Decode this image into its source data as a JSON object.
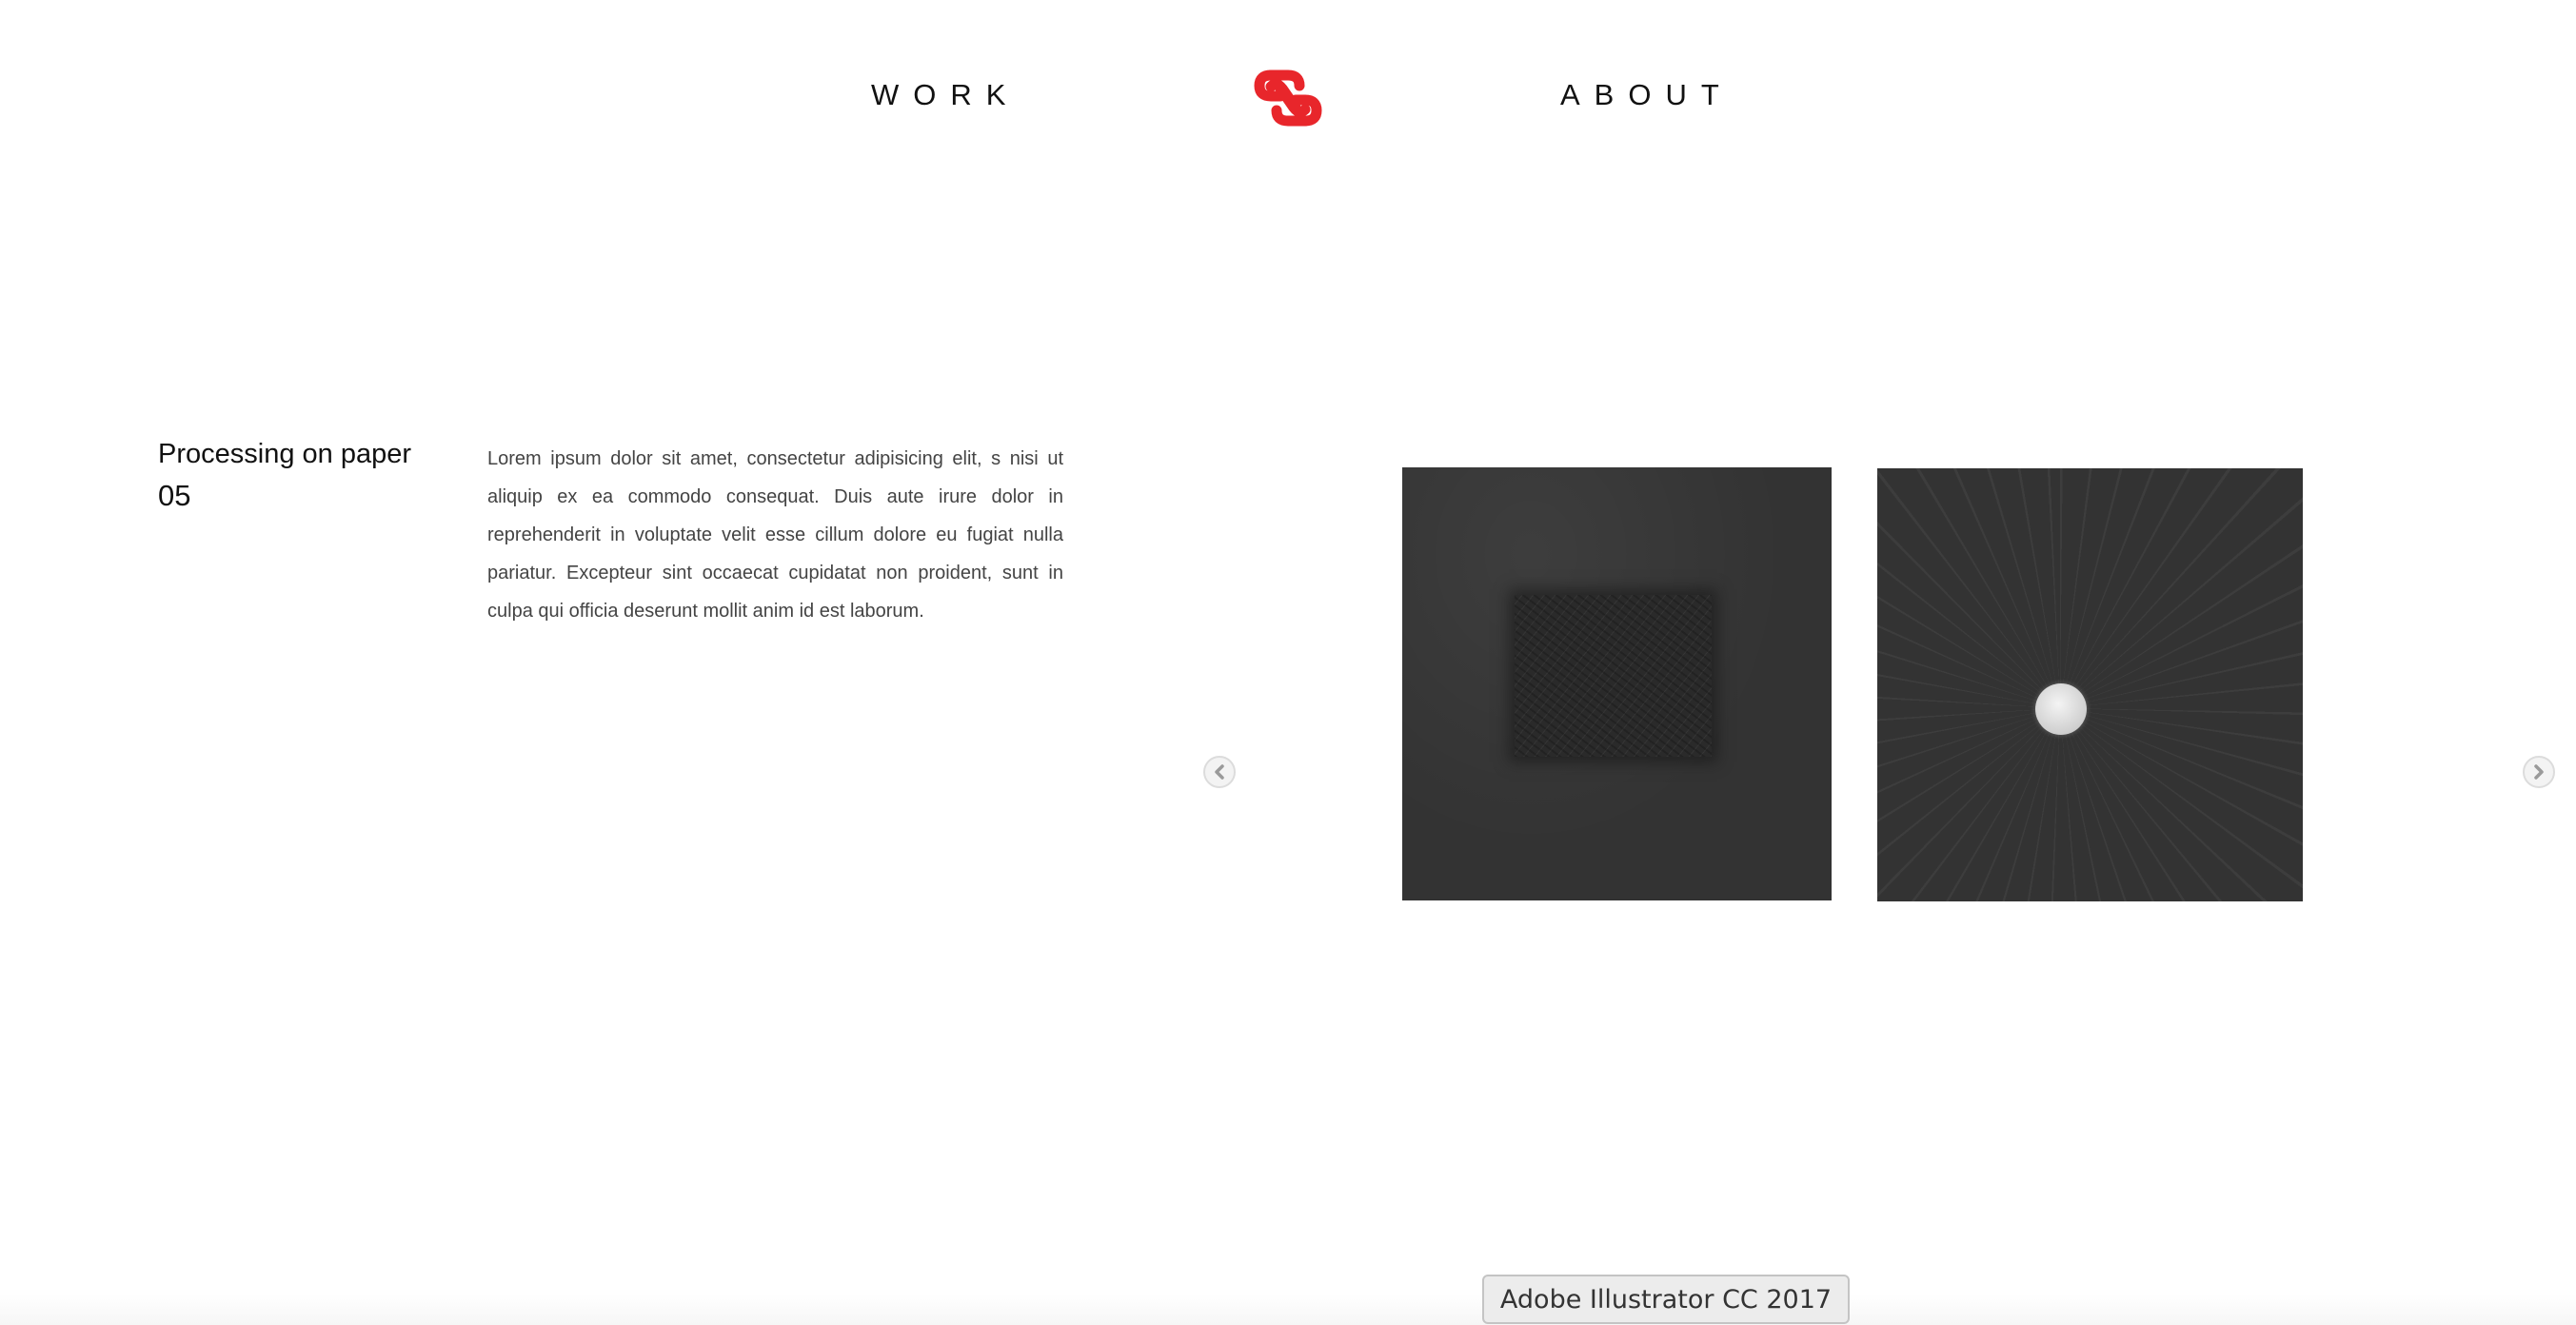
{
  "nav": {
    "work_label": "WORK",
    "about_label": "ABOUT",
    "logo_icon": "knot-logo-icon",
    "accent_color": "#e8262b"
  },
  "project": {
    "title": "Processing on paper",
    "number": "05",
    "description": "Lorem ipsum dolor sit amet, consectetur adipisicing elit, s nisi ut aliquip ex ea commodo consequat. Duis aute irure dolor in reprehenderit in voluptate velit esse cillum dolore eu fugiat nulla pariatur. Excepteur sint occaecat cupidatat non proident, sunt in culpa qui officia deserunt mollit anim id est laborum."
  },
  "gallery": {
    "prev_icon": "chevron-left-icon",
    "next_icon": "chevron-right-icon",
    "artworks": [
      "dark-textured-square",
      "dark-radial-disc"
    ]
  },
  "tooltip": {
    "text": "Adobe Illustrator CC 2017"
  }
}
